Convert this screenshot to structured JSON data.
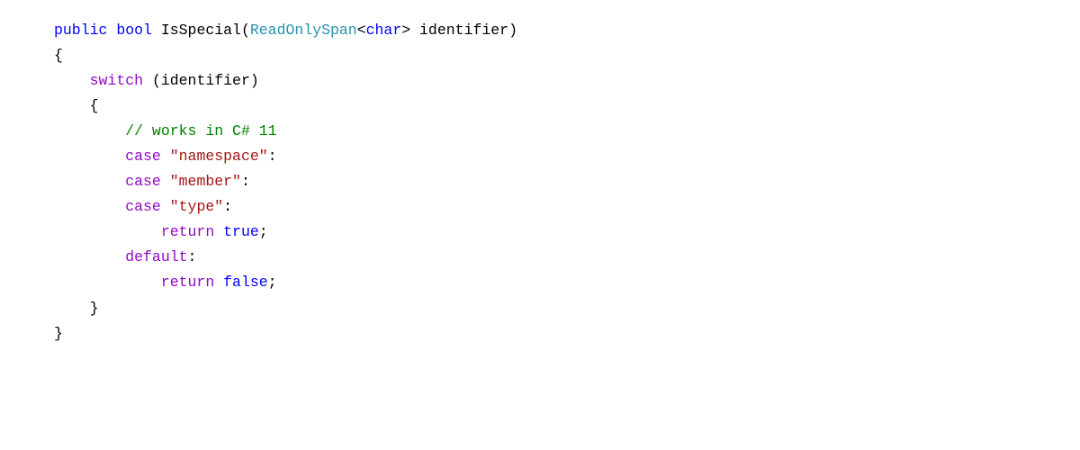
{
  "code": {
    "kw_public": "public",
    "kw_bool": "bool",
    "method_name": "IsSpecial",
    "type_readonlyspan": "ReadOnlySpan",
    "kw_char": "char",
    "param_identifier": "identifier",
    "kw_switch": "switch",
    "switch_expr": "identifier",
    "comment_text": "// works in C# 11",
    "kw_case1": "case",
    "str_namespace": "\"namespace\"",
    "kw_case2": "case",
    "str_member": "\"member\"",
    "kw_case3": "case",
    "str_type": "\"type\"",
    "kw_return1": "return",
    "kw_true": "true",
    "kw_default": "default",
    "kw_return2": "return",
    "kw_false": "false"
  }
}
